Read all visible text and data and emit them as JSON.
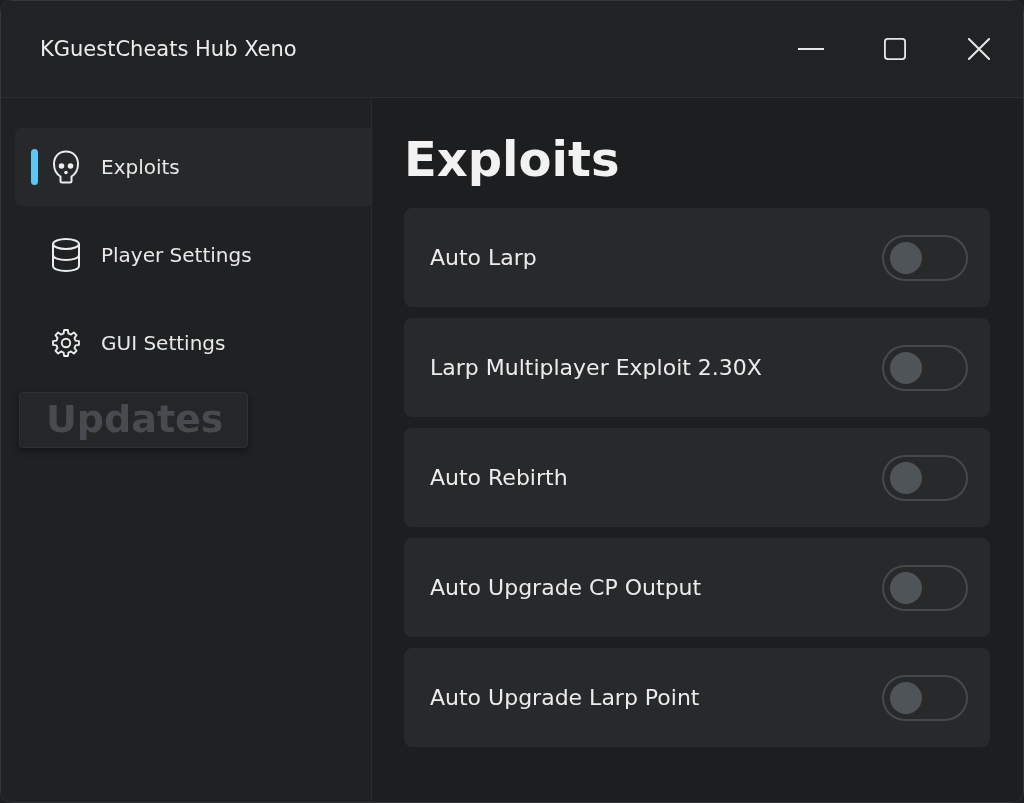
{
  "window": {
    "title": "KGuestCheats Hub Xeno"
  },
  "sidebar": {
    "items": [
      {
        "label": "Exploits",
        "selected": true
      },
      {
        "label": "Player Settings",
        "selected": false
      },
      {
        "label": "GUI Settings",
        "selected": false
      }
    ],
    "ghost_tab": {
      "label": "Updates"
    }
  },
  "page": {
    "heading": "Exploits",
    "toggles": [
      {
        "label": "Auto Larp",
        "on": false
      },
      {
        "label": "Larp Multiplayer Exploit 2.30X",
        "on": false
      },
      {
        "label": "Auto Rebirth",
        "on": false
      },
      {
        "label": "Auto Upgrade CP Output",
        "on": false
      },
      {
        "label": "Auto Upgrade Larp Point",
        "on": false
      }
    ]
  }
}
